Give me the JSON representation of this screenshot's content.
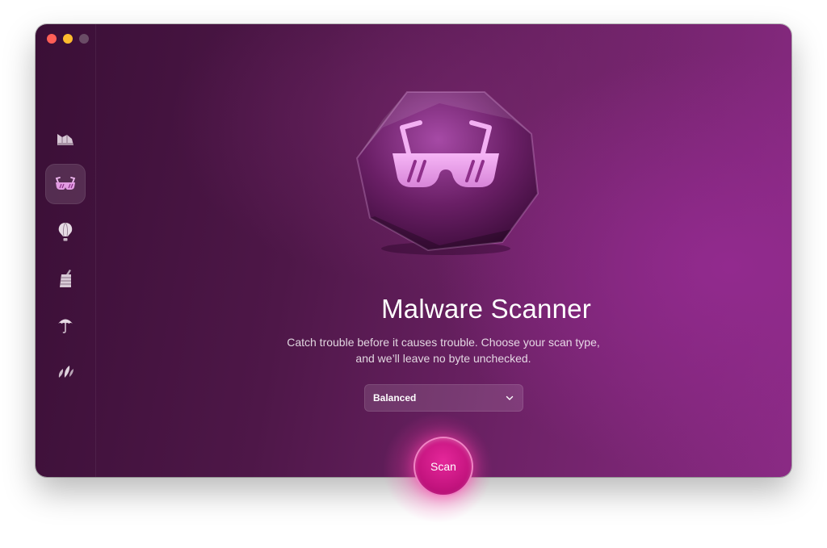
{
  "window": {
    "controls": [
      "close",
      "minimize",
      "zoom"
    ]
  },
  "sidebar": {
    "items": [
      {
        "id": "cleanup",
        "icon": "broom-stack-icon",
        "active": false
      },
      {
        "id": "protection",
        "icon": "sunglasses-icon",
        "active": true
      },
      {
        "id": "speed",
        "icon": "air-balloon-icon",
        "active": false
      },
      {
        "id": "applications",
        "icon": "cabinet-icon",
        "active": false
      },
      {
        "id": "clutter",
        "icon": "umbrella-icon",
        "active": false
      },
      {
        "id": "assistant",
        "icon": "leaves-icon",
        "active": false
      }
    ]
  },
  "main": {
    "hero_icon": "sunglasses-icon",
    "title": "Malware Scanner",
    "subtitle_line1": "Catch trouble before it causes trouble. Choose your scan type,",
    "subtitle_line2": "and we’ll leave no byte unchecked.",
    "scan_type": {
      "selected": "Balanced"
    },
    "scan_button": "Scan"
  },
  "colors": {
    "accent": "#d81b8c",
    "background_dark": "#3a0f36",
    "background_light": "#922a8e",
    "icon_pink": "#e8a3e8"
  }
}
